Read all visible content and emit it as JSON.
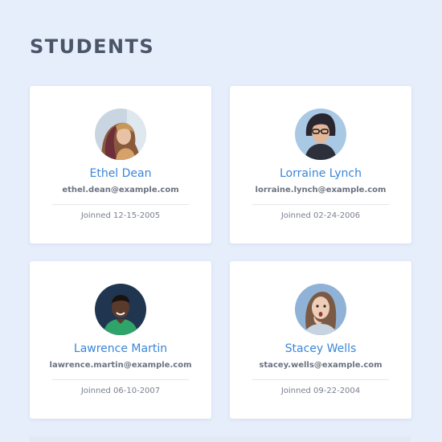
{
  "page": {
    "title": "STUDENTS"
  },
  "students": [
    {
      "name": "Ethel Dean",
      "email": "ethel.dean@example.com",
      "joined": "Joinned 12-15-2005",
      "avatar_icon": "avatar-photo-icon"
    },
    {
      "name": "Lorraine Lynch",
      "email": "lorraine.lynch@example.com",
      "joined": "Joinned 02-24-2006",
      "avatar_icon": "avatar-photo-icon"
    },
    {
      "name": "Lawrence Martin",
      "email": "lawrence.martin@example.com",
      "joined": "Joinned 06-10-2007",
      "avatar_icon": "avatar-photo-icon"
    },
    {
      "name": "Stacey Wells",
      "email": "stacey.wells@example.com",
      "joined": "Joinned 09-22-2004",
      "avatar_icon": "avatar-photo-icon"
    }
  ],
  "colors": {
    "background": "#e6eefb",
    "title": "#4a5568",
    "name_link": "#3a86d8",
    "card": "#ffffff"
  }
}
